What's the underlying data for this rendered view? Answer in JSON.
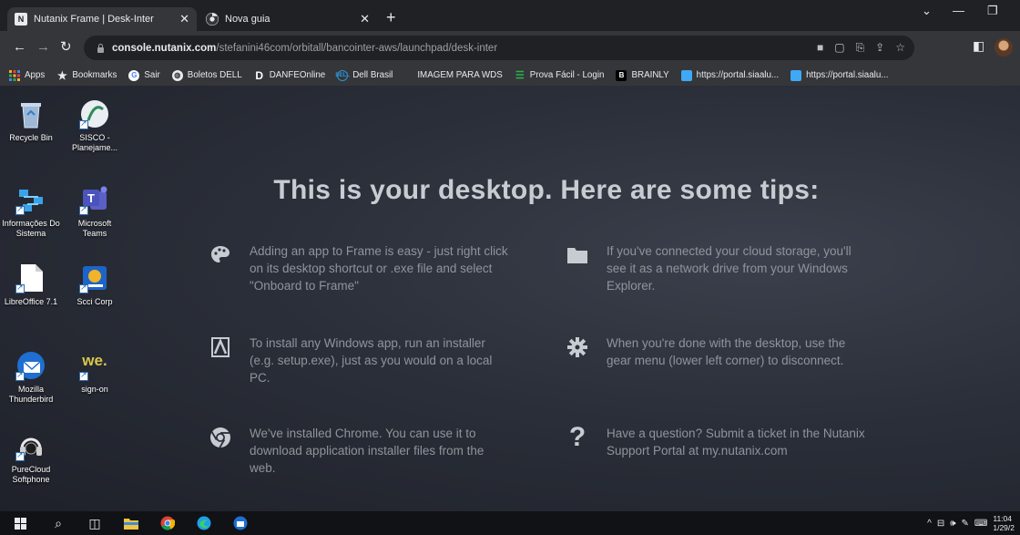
{
  "browser": {
    "tabs": [
      {
        "title": "Nutanix Frame | Desk-Inter",
        "favicon": "N",
        "active": true
      },
      {
        "title": "Nova guia",
        "favicon": "chrome-icon",
        "active": false
      }
    ],
    "url_host": "console.nutanix.com",
    "url_path": "/stefanini46com/orbitall/bancointer-aws/launchpad/desk-inter",
    "bookmarks": [
      {
        "label": "Apps",
        "icon": "apps-grid-icon",
        "color": "#f2b134"
      },
      {
        "label": "Bookmarks",
        "icon": "star-icon",
        "color": "#e8eaed"
      },
      {
        "label": "Sair",
        "icon": "google-icon",
        "color": "#4285f4"
      },
      {
        "label": "Boletos DELL",
        "icon": "globe-icon",
        "color": "#e8eaed"
      },
      {
        "label": "DANFEOnline",
        "icon": "d-icon",
        "color": "#ffffff"
      },
      {
        "label": "Dell Brasil",
        "icon": "dell-icon",
        "color": "#2b95d6"
      },
      {
        "label": "IMAGEM PARA WDS",
        "icon": "",
        "color": ""
      },
      {
        "label": "Prova Fácil - Login",
        "icon": "list-icon",
        "color": "#29b24b"
      },
      {
        "label": "BRAINLY",
        "icon": "b-icon",
        "color": "#ffffff"
      },
      {
        "label": "https://portal.siaalu...",
        "icon": "portal-icon",
        "color": "#3fa9f5"
      },
      {
        "label": "https://portal.siaalu...",
        "icon": "portal-icon",
        "color": "#3fa9f5"
      }
    ]
  },
  "desktop": {
    "icons": [
      {
        "label": "Recycle Bin",
        "icon": "recycle-bin-icon"
      },
      {
        "label": "SISCO - Planejame...",
        "icon": "sisco-icon"
      },
      {
        "label": "Informações Do Sistema",
        "icon": "system-info-icon"
      },
      {
        "label": "Microsoft Teams",
        "icon": "teams-icon"
      },
      {
        "label": "LibreOffice 7.1",
        "icon": "libreoffice-icon"
      },
      {
        "label": "Scci Corp",
        "icon": "scci-icon"
      },
      {
        "label": "Mozilla Thunderbird",
        "icon": "thunderbird-icon"
      },
      {
        "label": "sign-on",
        "icon": "we-icon",
        "logo_text": "we."
      },
      {
        "label": "PureCloud Softphone",
        "icon": "headset-icon"
      }
    ],
    "tips_title": "This is your desktop. Here are some tips:",
    "tips": [
      {
        "icon": "palette-icon",
        "text": "Adding an app to Frame is easy - just right click on its desktop shortcut or .exe file and select \"Onboard to Frame\""
      },
      {
        "icon": "folder-icon",
        "text": "If you've connected your cloud storage, you'll see it as a network drive from your Windows Explorer."
      },
      {
        "icon": "installer-icon",
        "text": "To install any Windows app, run an installer (e.g. setup.exe), just as you would on a local PC."
      },
      {
        "icon": "gear-icon",
        "text": "When you're done with the desktop, use the gear menu (lower left corner) to disconnect."
      },
      {
        "icon": "chrome-icon",
        "text": "We've installed Chrome. You can use it to download application installer files from the web."
      },
      {
        "icon": "question-icon",
        "text": "Have a question? Submit a ticket in the Nutanix Support Portal at my.nutanix.com"
      }
    ]
  },
  "taskbar": {
    "time": "11:04",
    "date": "1/29/2"
  }
}
